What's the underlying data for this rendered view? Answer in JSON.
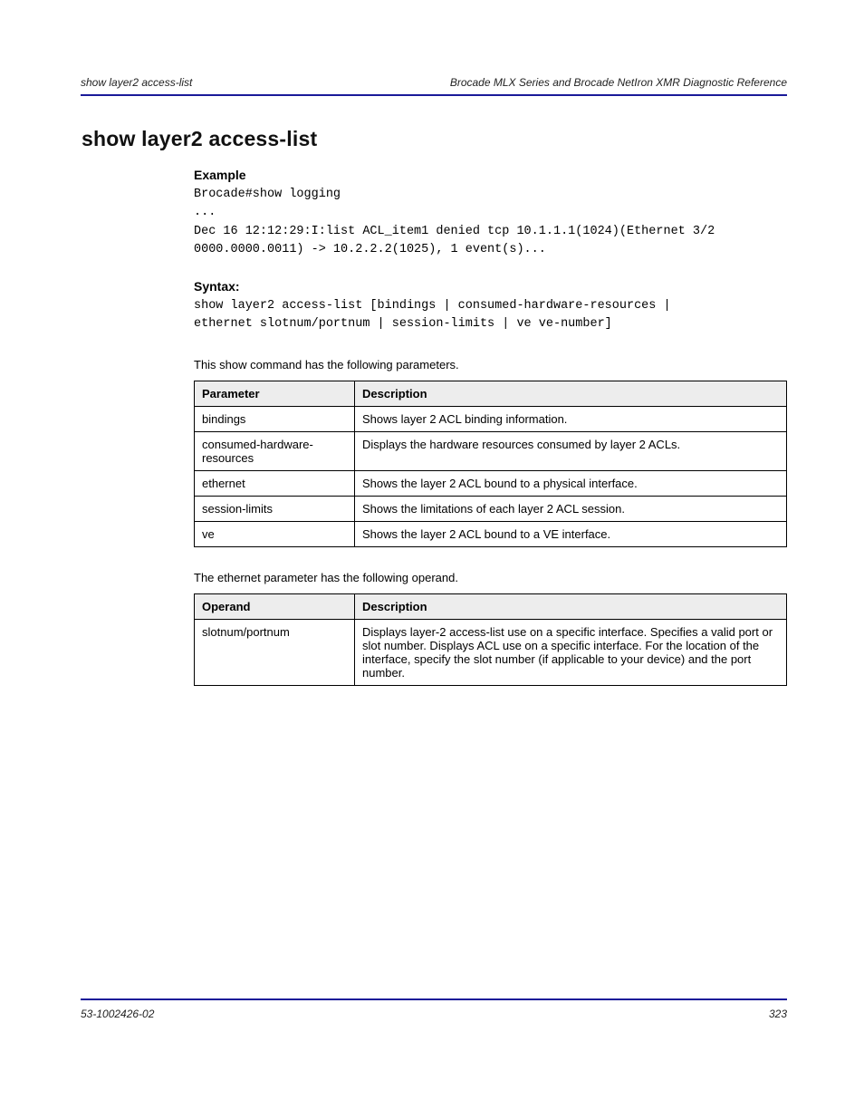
{
  "header": {
    "left": "show layer2 access-list",
    "right": "Brocade MLX Series and Brocade NetIron XMR Diagnostic Reference"
  },
  "footer": {
    "left": "53-1002426-02",
    "right": "323"
  },
  "title": "show layer2 access-list",
  "example": {
    "heading": "Example",
    "text": "Brocade#show logging\n...\nDec 16 12:12:29:I:list ACL_item1 denied tcp 10.1.1.1(1024)(Ethernet 3/2\n0000.0000.0011) -> 10.2.2.2(1025), 1 event(s)..."
  },
  "syntax": {
    "heading": "Syntax:",
    "text": "show layer2 access-list [bindings | consumed-hardware-resources |\nethernet slotnum/portnum | session-limits | ve ve-number]"
  },
  "table1": {
    "caption": "This show command has the following parameters.",
    "headers": [
      "Parameter",
      "Description"
    ],
    "rows": [
      [
        "bindings",
        "Shows layer 2 ACL binding information."
      ],
      [
        "consumed-hardware-resources",
        "Displays the hardware resources consumed by layer 2 ACLs."
      ],
      [
        "ethernet",
        "Shows the layer 2 ACL bound to a physical interface."
      ],
      [
        "session-limits",
        "Shows the limitations of each layer 2 ACL session."
      ],
      [
        "ve",
        "Shows the layer 2 ACL bound to a VE interface."
      ]
    ]
  },
  "table2": {
    "caption": "The ethernet parameter has the following operand.",
    "headers": [
      "Operand",
      "Description"
    ],
    "rows": [
      [
        "slotnum/portnum",
        "Displays layer-2 access-list use on a specific interface. Specifies a valid port or slot number. Displays ACL use on a specific interface. For the location of the interface, specify the slot number (if applicable to your device) and the port number."
      ]
    ]
  }
}
